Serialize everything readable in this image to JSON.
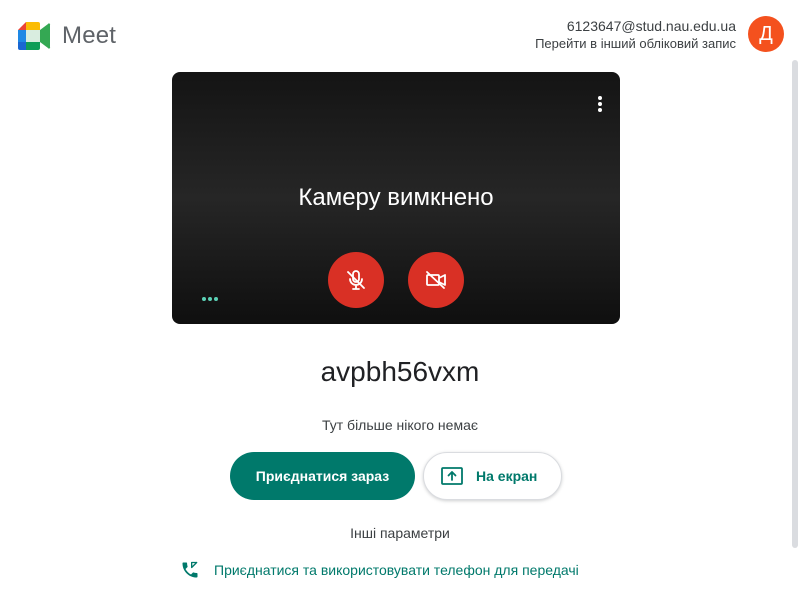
{
  "header": {
    "app_name": "Meet",
    "account_email": "6123647@stud.nau.edu.ua",
    "switch_account": "Перейти в інший обліковий запис",
    "avatar_letter": "Д",
    "avatar_color": "#f4511e"
  },
  "preview": {
    "camera_off_text": "Камеру вимкнено",
    "more_options_icon": "more-vert-icon",
    "mic_icon": "mic-off-icon",
    "camera_icon": "videocam-off-icon",
    "control_color": "#d93025"
  },
  "meeting": {
    "code": "avpbh56vxm",
    "status_text": "Тут більше нікого немає",
    "join_button": "Приєднатися зараз",
    "present_button": "На екран",
    "present_icon": "present-to-screen-icon",
    "other_options": "Інші параметри",
    "phone_option": "Приєднатися та використовувати телефон для передачі",
    "phone_icon": "phone-forwarded-icon",
    "accent_color": "#00796b"
  }
}
